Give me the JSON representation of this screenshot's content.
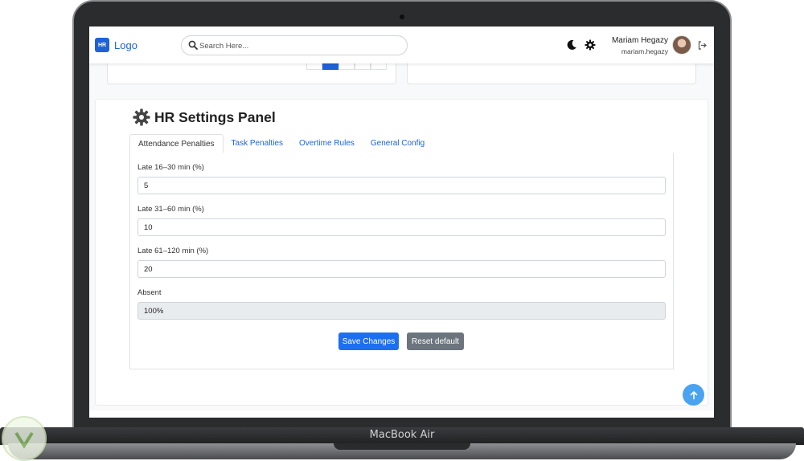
{
  "device": {
    "label": "MacBook Air"
  },
  "navbar": {
    "logo_badge": "HR",
    "logo_text": "Logo",
    "search_placeholder": "Search Here...",
    "user_name": "Mariam Hegazy",
    "user_handle": "mariam.hegazy",
    "icons": [
      "search-icon",
      "moon-icon",
      "gear-icon",
      "avatar",
      "logout-icon"
    ]
  },
  "panel": {
    "title": "HR Settings Panel",
    "tabs": [
      {
        "label": "Attendance Penalties",
        "active": true
      },
      {
        "label": "Task Penalties",
        "active": false
      },
      {
        "label": "Overtime Rules",
        "active": false
      },
      {
        "label": "General Config",
        "active": false
      }
    ],
    "fields": [
      {
        "label": "Late 16–30 min (%)",
        "value": "5",
        "readonly": false
      },
      {
        "label": "Late 31–60 min (%)",
        "value": "10",
        "readonly": false
      },
      {
        "label": "Late 61–120 min (%)",
        "value": "20",
        "readonly": false
      },
      {
        "label": "Absent",
        "value": "100%",
        "readonly": true
      }
    ],
    "save_label": "Save Changes",
    "reset_label": "Reset default"
  },
  "colors": {
    "primary": "#1d6ff2",
    "secondary": "#6c757d",
    "link": "#1d63d6",
    "scroll_top": "#4aa3f0"
  }
}
